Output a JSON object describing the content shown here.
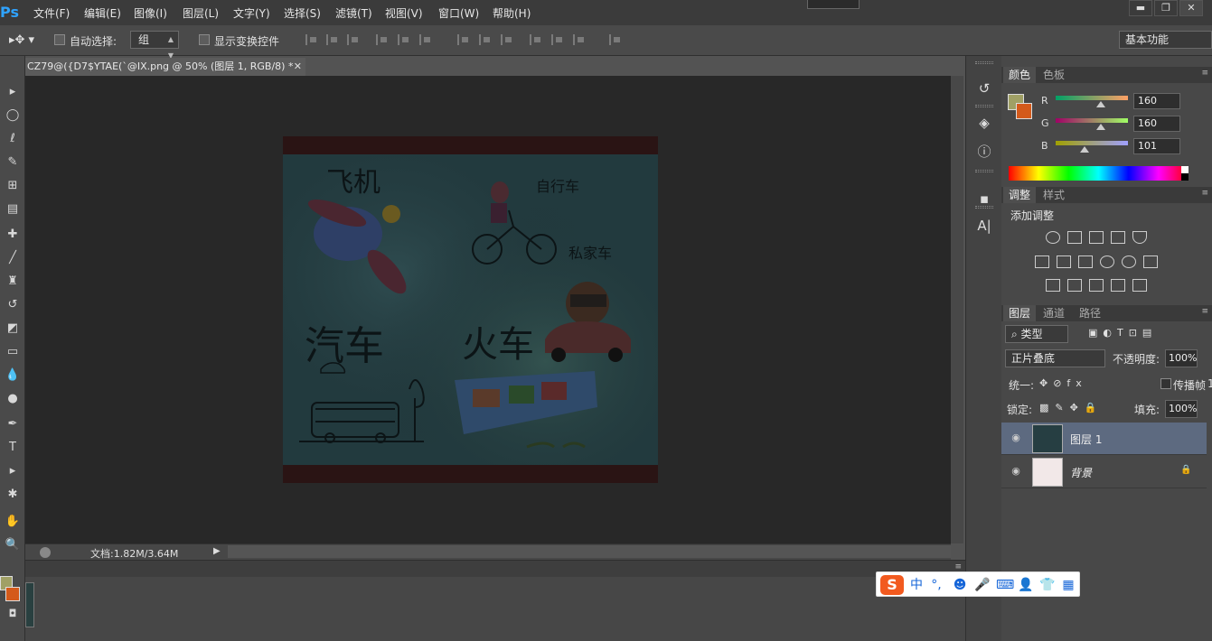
{
  "app": {
    "logo": "Ps"
  },
  "menu": [
    "文件(F)",
    "编辑(E)",
    "图像(I)",
    "图层(L)",
    "文字(Y)",
    "选择(S)",
    "滤镜(T)",
    "视图(V)",
    "窗口(W)",
    "帮助(H)"
  ],
  "window_controls": {
    "minimize": "▬",
    "restore": "❐",
    "close": "✕"
  },
  "options": {
    "auto_select_label": "自动选择:",
    "auto_select_value": "组",
    "show_transform_label": "显示变换控件",
    "workspace": "基本功能"
  },
  "document": {
    "tab_title": "CZ79@({D7$YTAE(`@IX.png @ 50% (图层 1, RGB/8) *",
    "close": "✕",
    "status": "文档:1.82M/3.64M"
  },
  "canvas_labels": {
    "plane": "飞机",
    "bicycle": "自行车",
    "private_car": "私家车",
    "car": "汽车",
    "train": "火车"
  },
  "color_panel": {
    "tabs": [
      "颜色",
      "色板"
    ],
    "r_label": "R",
    "g_label": "G",
    "b_label": "B",
    "r": "160",
    "g": "160",
    "b": "101",
    "foreground": "#a0a065",
    "background": "#d45a1b"
  },
  "adjust_panel": {
    "tabs": [
      "调整",
      "样式"
    ],
    "title": "添加调整"
  },
  "layers_panel": {
    "tabs": [
      "图层",
      "通道",
      "路径"
    ],
    "filter_kind": "类型",
    "blend_mode": "正片叠底",
    "opacity_label": "不透明度:",
    "opacity": "100%",
    "unify_label": "统一:",
    "propagate_label": "传播帧",
    "propagate_suffix": "1",
    "lock_label": "锁定:",
    "fill_label": "填充:",
    "fill": "100%",
    "layers": [
      {
        "name": "图层 1",
        "selected": true
      },
      {
        "name": "背景",
        "locked": true
      }
    ]
  },
  "ime": {
    "logo": "S",
    "lang": "中",
    "punct": "°,"
  }
}
